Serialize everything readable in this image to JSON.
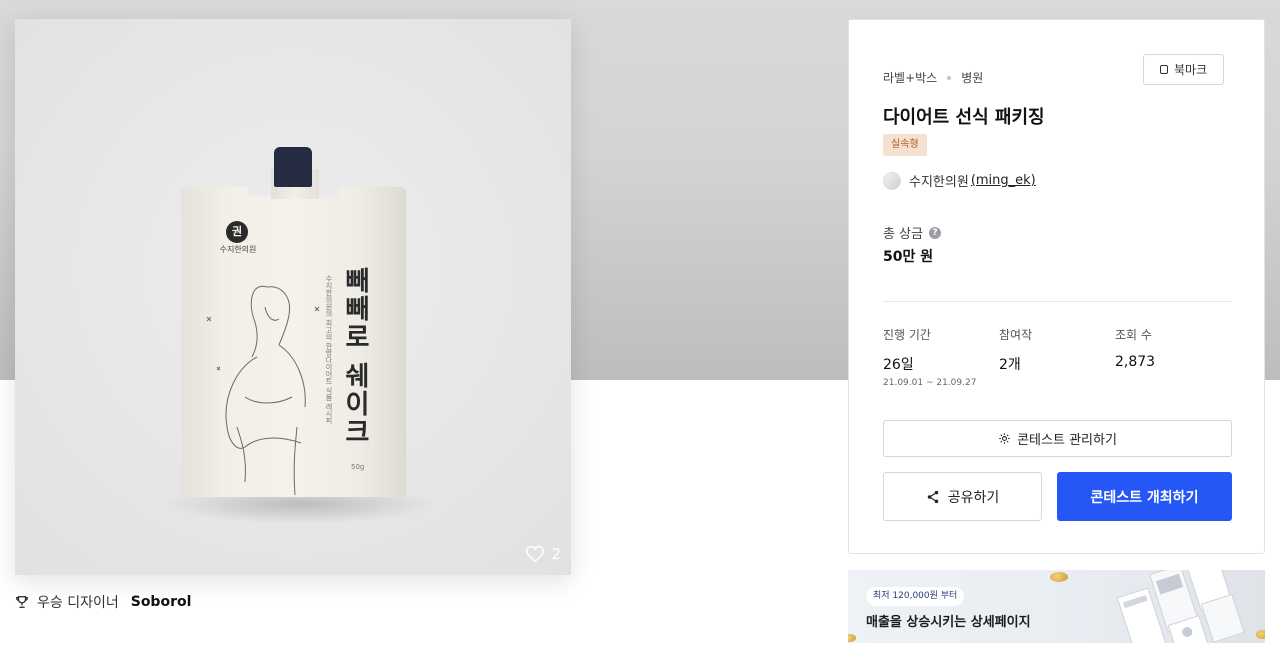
{
  "product": {
    "cap_color": "#252b40",
    "pouch_logo_text": "권",
    "pouch_brand": "수지한의원",
    "pouch_title": "빼빼로 쉐이크",
    "pouch_subtitle": "수지한의원의 최고의 한방다이어트 식품 레시피",
    "pouch_weight": "50g",
    "likes": "2"
  },
  "award": {
    "label": "우승 디자이너",
    "designer": "Soborol"
  },
  "panel": {
    "breadcrumb": [
      "라벨+박스",
      "병원"
    ],
    "bookmark_label": "북마크",
    "title": "다이어트 선식 패키징",
    "badge": "실속형",
    "author_name": "수지한의원",
    "author_handle": "(ming_ek)",
    "prize_label": "총 상금",
    "prize_help": "?",
    "prize_value": "50만 원",
    "stats": {
      "duration_label": "진행 기간",
      "duration_value": "26일",
      "duration_range": "21.09.01 ~ 21.09.27",
      "participants_label": "참여작",
      "participants_value": "2개",
      "views_label": "조회 수",
      "views_value": "2,873"
    },
    "manage_label": "콘테스트 관리하기",
    "share_label": "공유하기",
    "host_label": "콘테스트 개최하기",
    "accent_color": "#2457f5"
  },
  "ad": {
    "pill": "최저 120,000원 부터",
    "headline": "매출을 상승시키는 상세페이지"
  }
}
